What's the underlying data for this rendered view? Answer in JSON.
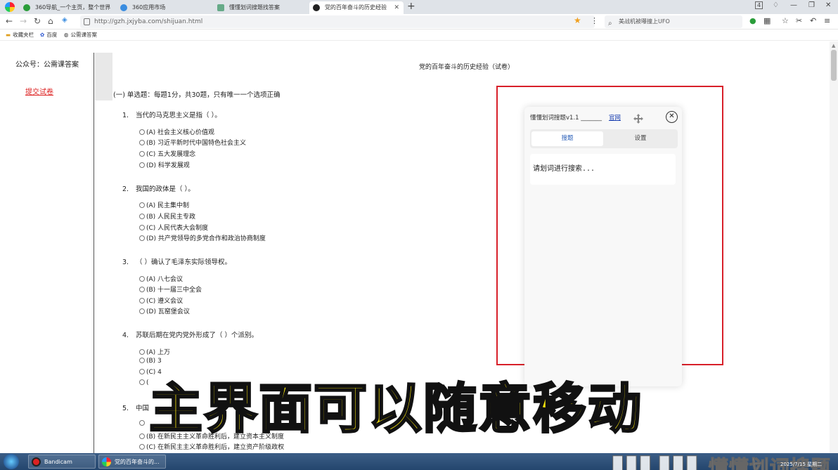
{
  "browser": {
    "tabs": [
      {
        "label": "360导航_一个主页，整个世界",
        "icon_color": "#2a9d3a"
      },
      {
        "label": "360应用市场",
        "icon_color": "#3b8de0"
      },
      {
        "label": "懂懂划词搜题找答案",
        "icon_color": "#6a8"
      },
      {
        "label": "党的百年奋斗的历史经验",
        "icon_color": "#222"
      }
    ],
    "new_tab": "+",
    "tab_count": "4",
    "url": "http://gzh.jxjyba.com/shijuan.html",
    "search_text": "美战机被曝撞上UFO",
    "bookmarks": [
      "收藏夹栏",
      "百度",
      "公需课答案"
    ]
  },
  "sidebar": {
    "title": "公众号：公需课答案",
    "submit": "提交试卷"
  },
  "exam": {
    "title": "党的百年奋斗的历史经验（试卷）",
    "section": "(一) 单选题：每题1分，共30题，只有唯一一个选项正确",
    "questions": [
      {
        "num": "1.",
        "text": "当代的马克思主义是指（ ）。",
        "options": [
          "(A) 社会主义核心价值观",
          "(B) 习近平新时代中国特色社会主义",
          "(C) 五大发展理念",
          "(D) 科学发展观"
        ]
      },
      {
        "num": "2.",
        "text": "我国的政体是（ ）。",
        "options": [
          "(A) 民主集中制",
          "(B) 人民民主专政",
          "(C) 人民代表大会制度",
          "(D) 共产党领导的多党合作和政治协商制度"
        ]
      },
      {
        "num": "3.",
        "text": "（ ）确认了毛泽东实际领导权。",
        "options": [
          "(A) 八七会议",
          "(B) 十一届三中全会",
          "(C) 遵义会议",
          "(D) 瓦窑堡会议"
        ]
      },
      {
        "num": "4.",
        "text": "苏联后期在党内党外形成了（ ）个派别。",
        "options": [
          "(A) 上万",
          "(B) 3",
          "(C) 4",
          "("
        ]
      },
      {
        "num": "5.",
        "text": "中国",
        "options": [
          "",
          "(B) 在新民主主义革命胜利后，建立资本主义制度",
          "(C) 在新民主主义革命胜利后，建立资产阶级政权"
        ]
      }
    ]
  },
  "panel": {
    "title": "懂懂划词搜题v1.1 _______",
    "link": "官网",
    "tab_search": "搜题",
    "tab_settings": "设置",
    "placeholder": "请划词进行搜索..."
  },
  "caption": "主界面可以随意移动",
  "taskbar": {
    "items": [
      "Bandicam",
      "党的百年奋斗的..."
    ],
    "watermark": "懂懂划词搜题",
    "clock": "2025/7/15 星期二"
  }
}
